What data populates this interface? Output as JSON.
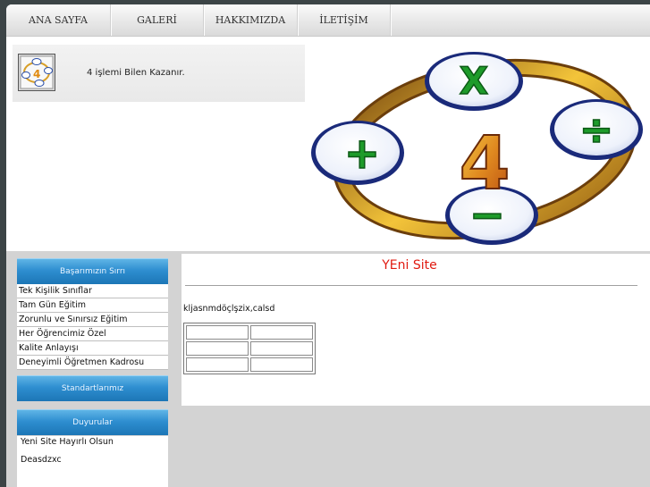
{
  "nav": {
    "items": [
      {
        "label": "ANA SAYFA"
      },
      {
        "label": "GALERİ"
      },
      {
        "label": "HAKKIMIZDA"
      },
      {
        "label": "İLETİŞİM"
      }
    ]
  },
  "header": {
    "slogan": "4 işlemi Bilen Kazanır.",
    "hero_symbols": {
      "times": "X",
      "divide": "÷",
      "plus": "+",
      "minus": "−",
      "number": "4"
    }
  },
  "sidebar": {
    "success_title": "Başarımızın Sırrı",
    "items": [
      {
        "label": "Tek Kişilik Sınıflar"
      },
      {
        "label": "Tam Gün Eğitim"
      },
      {
        "label": "Zorunlu ve Sınırsız Eğitim"
      },
      {
        "label": "Her Öğrencimiz Özel"
      },
      {
        "label": "Kalite Anlayışı"
      },
      {
        "label": "Deneyimli Öğretmen Kadrosu"
      }
    ],
    "standards_title": "Standartlarımız",
    "announcements_title": "Duyurular",
    "announcements": [
      {
        "label": "Yeni Site Hayırlı Olsun"
      },
      {
        "label": "Deasdzxc"
      }
    ]
  },
  "main": {
    "title": "YEni Site",
    "text": "kljasnmdöçlşzix,calsd",
    "table_rows": 3,
    "table_cols": 2
  },
  "colors": {
    "title_red": "#e01a10",
    "sidebar_header_blue": "#2e8ed0",
    "frame_dark": "#3c4446",
    "content_gray": "#d3d3d3"
  }
}
